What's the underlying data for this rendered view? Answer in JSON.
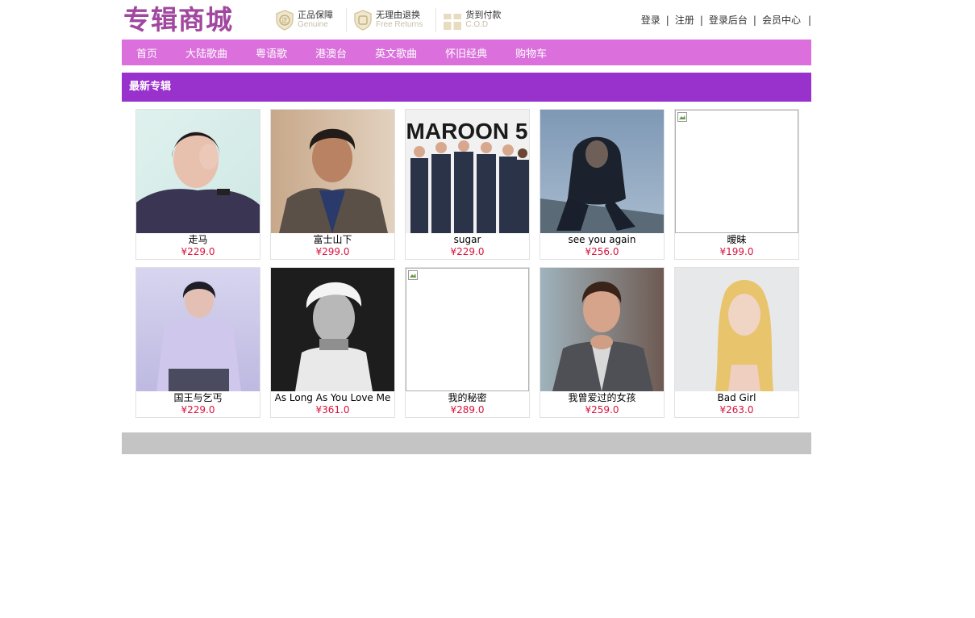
{
  "header": {
    "logo": "专辑商城",
    "badges": [
      {
        "cn": "正品保障",
        "en": "Genuine",
        "icon": "shield-genuine-icon"
      },
      {
        "cn": "无理由退换",
        "en": "Free Returns",
        "icon": "shield-return-icon"
      },
      {
        "cn": "货到付款",
        "en": "C.O.D",
        "icon": "gift-box-icon"
      }
    ],
    "links": [
      "登录",
      "注册",
      "登录后台",
      "会员中心"
    ]
  },
  "nav": [
    "首页",
    "大陆歌曲",
    "粤语歌",
    "港澳台",
    "英文歌曲",
    "怀旧经典",
    "购物车"
  ],
  "section": {
    "title": "最新专辑"
  },
  "albums": [
    {
      "title": "走马",
      "price": "¥229.0"
    },
    {
      "title": "富士山下",
      "price": "¥299.0"
    },
    {
      "title": "sugar",
      "price": "¥229.0",
      "cover_text": "MAROON 5"
    },
    {
      "title": "see you again",
      "price": "¥256.0"
    },
    {
      "title": "暧昧",
      "price": "¥199.0"
    },
    {
      "title": "国王与乞丐",
      "price": "¥229.0"
    },
    {
      "title": "As Long As You Love Me",
      "price": "¥361.0"
    },
    {
      "title": "我的秘密",
      "price": "¥289.0"
    },
    {
      "title": "我曾爱过的女孩",
      "price": "¥259.0"
    },
    {
      "title": "Bad Girl",
      "price": "¥263.0"
    }
  ]
}
